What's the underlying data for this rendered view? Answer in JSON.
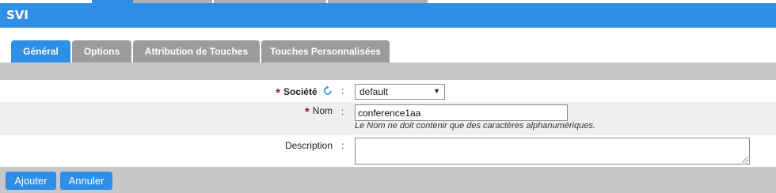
{
  "header": {
    "title": "SVI"
  },
  "tabs": [
    {
      "label": "Général",
      "active": true
    },
    {
      "label": "Options",
      "active": false
    },
    {
      "label": "Attribution de Touches",
      "active": false
    },
    {
      "label": "Touches Personnalisées",
      "active": false
    }
  ],
  "form": {
    "societe": {
      "label": "Société",
      "required": true,
      "value": "default",
      "separator": ":"
    },
    "nom": {
      "label": "Nom",
      "required": true,
      "value": "conference1aa",
      "hint": "Le Nom ne doit contenir que des caractères alphanumériques.",
      "separator": ":"
    },
    "description": {
      "label": "Description",
      "required": false,
      "value": "",
      "separator": ":"
    }
  },
  "required_marker": "*",
  "select_arrow": "▼",
  "actions": {
    "add_label": "Ajouter",
    "cancel_label": "Annuler"
  },
  "colors": {
    "accent": "#2f8ee5",
    "inactive_tab": "#9c9c9c",
    "bar": "#c7c7c7",
    "required": "#a01515"
  }
}
